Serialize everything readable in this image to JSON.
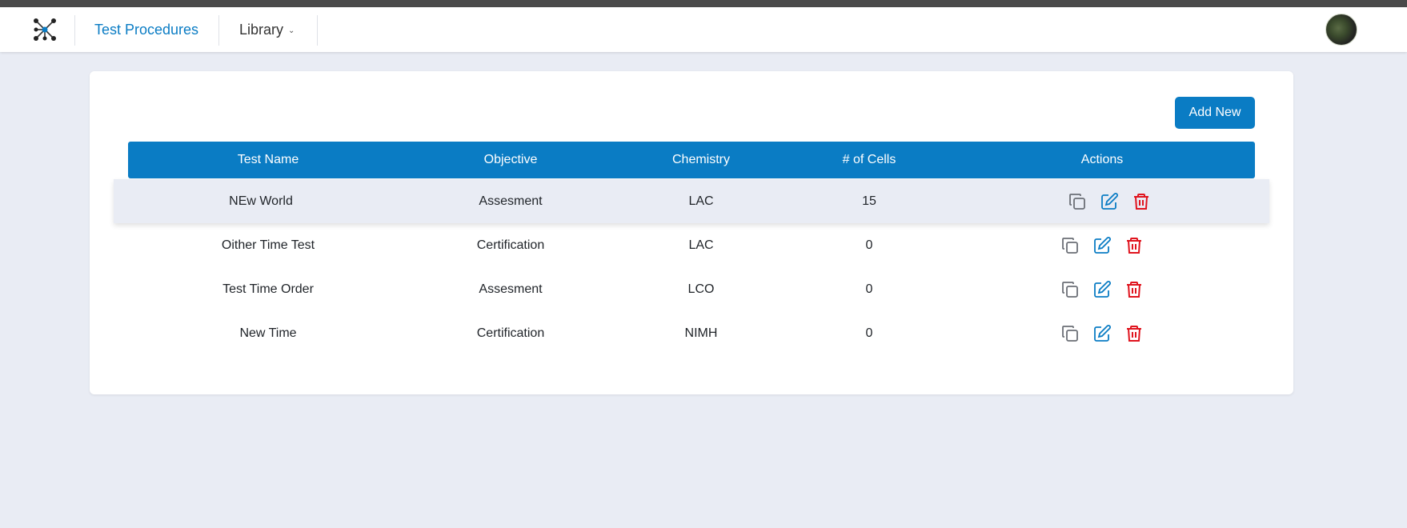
{
  "nav": {
    "logo_icon": "molecule-logo-icon",
    "items": [
      {
        "label": "Test Procedures",
        "active": true
      },
      {
        "label": "Library",
        "dropdown": true
      }
    ],
    "avatar_icon": "user-avatar"
  },
  "toolbar": {
    "add_label": "Add New"
  },
  "table": {
    "headers": [
      "Test Name",
      "Objective",
      "Chemistry",
      "# of Cells",
      "Actions"
    ],
    "rows": [
      {
        "name": "NEw World",
        "objective": "Assesment",
        "chemistry": "LAC",
        "cells": "15"
      },
      {
        "name": "Oither Time Test",
        "objective": "Certification",
        "chemistry": "LAC",
        "cells": "0"
      },
      {
        "name": "Test Time Order",
        "objective": "Assesment",
        "chemistry": "LCO",
        "cells": "0"
      },
      {
        "name": "New Time",
        "objective": "Certification",
        "chemistry": "NIMH",
        "cells": "0"
      }
    ],
    "action_icons": [
      "copy-icon",
      "edit-icon",
      "delete-icon"
    ]
  },
  "colors": {
    "accent": "#0a7cc4",
    "danger": "#e0141e",
    "muted_icon": "#6b6f76",
    "page_bg": "#e9ecf4"
  }
}
